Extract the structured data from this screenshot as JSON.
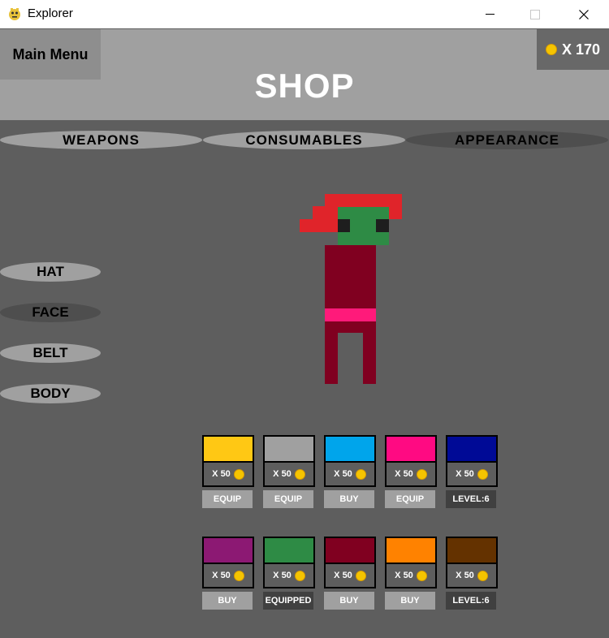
{
  "window": {
    "title": "Explorer",
    "app_icon": "pygame-snake-icon",
    "controls": [
      "minimize-icon",
      "maximize-icon",
      "close-icon"
    ]
  },
  "header": {
    "main_menu_label": "Main Menu",
    "title": "SHOP",
    "coin_count": "X 170",
    "coin_icon": "coin-icon",
    "coin_color": "#f5c400"
  },
  "tabs": [
    {
      "label": "WEAPONS",
      "selected": false
    },
    {
      "label": "CONSUMABLES",
      "selected": false
    },
    {
      "label": "APPEARANCE",
      "selected": true
    }
  ],
  "categories": [
    {
      "label": "HAT",
      "selected": false
    },
    {
      "label": "FACE",
      "selected": true
    },
    {
      "label": "BELT",
      "selected": false
    },
    {
      "label": "BODY",
      "selected": false
    }
  ],
  "character": {
    "hat_color": "#e0242a",
    "face_color": "#2e8b45",
    "eye_color": "#1e1e1e",
    "body_color": "#800020",
    "belt_color": "#ff1a7a"
  },
  "items": [
    {
      "color": "#ffc814",
      "price": "X 50",
      "action": "EQUIP"
    },
    {
      "color": "#a0a0a0",
      "price": "X 50",
      "action": "EQUIP"
    },
    {
      "color": "#00a5eb",
      "price": "X 50",
      "action": "BUY"
    },
    {
      "color": "#ff0a82",
      "price": "X 50",
      "action": "EQUIP"
    },
    {
      "color": "#000a96",
      "price": "X 50",
      "action": "LEVEL:6"
    },
    {
      "color": "#8c1973",
      "price": "X 50",
      "action": "BUY"
    },
    {
      "color": "#2e8b45",
      "price": "X 50",
      "action": "EQUIPPED"
    },
    {
      "color": "#800020",
      "price": "X 50",
      "action": "BUY"
    },
    {
      "color": "#ff8200",
      "price": "X 50",
      "action": "BUY"
    },
    {
      "color": "#643200",
      "price": "X 50",
      "action": "LEVEL:6"
    }
  ]
}
